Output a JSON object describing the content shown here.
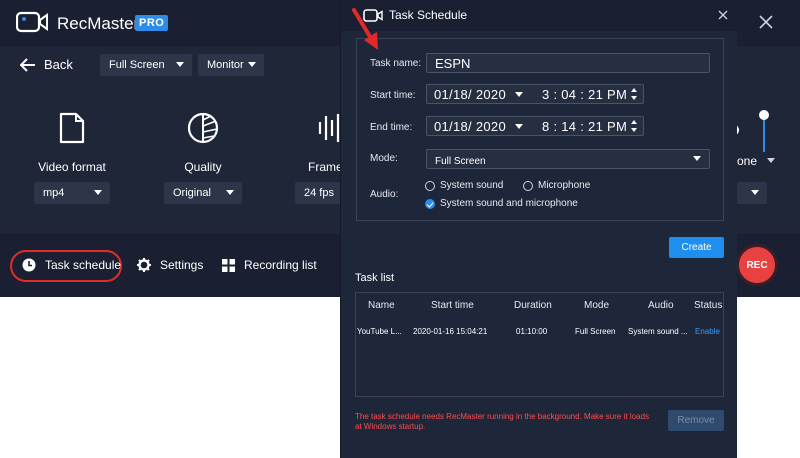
{
  "app": {
    "name": "RecMaster",
    "badge": "PRO"
  },
  "nav": {
    "back_label": "Back"
  },
  "toolbar": {
    "area_select": "Full Screen",
    "display_select": "Monitor"
  },
  "features": [
    {
      "label": "Video format",
      "value": "mp4",
      "icon": "file-icon"
    },
    {
      "label": "Quality",
      "value": "Original",
      "icon": "quality-dial-icon"
    },
    {
      "label": "Frame",
      "value": "24 fps",
      "icon": "frame-rate-icon"
    },
    {
      "label": "one",
      "icon": "microphone-icon"
    }
  ],
  "bottom": {
    "task_schedule": "Task schedule",
    "settings": "Settings",
    "recording_list": "Recording list",
    "rec": "REC"
  },
  "dialog": {
    "title": "Task Schedule",
    "task_name_label": "Task name:",
    "task_name_value": "ESPN",
    "start_label": "Start time:",
    "start_date": "01/18/ 2020",
    "start_time": "3 : 04 : 21  PM",
    "end_label": "End time:",
    "end_date": "01/18/ 2020",
    "end_time": "8 : 14 : 21  PM",
    "mode_label": "Mode:",
    "mode_value": "Full Screen",
    "audio_label": "Audio:",
    "audio_options": [
      "System sound",
      "Microphone",
      "System sound and microphone"
    ],
    "audio_selected": "System sound and microphone",
    "create_label": "Create",
    "tasklist_label": "Task list",
    "columns": [
      "Name",
      "Start time",
      "Duration",
      "Mode",
      "Audio",
      "Status"
    ],
    "rows": [
      {
        "name": "YouTube L...",
        "start": "2020-01-16 15:04:21",
        "duration": "01:10:00",
        "mode": "Full Screen",
        "audio": "System sound ...",
        "status": "Enable"
      }
    ],
    "warning": "The task schedule needs RecMaster running in the background. Make sure it loads at Windows startup.",
    "remove_label": "Remove"
  },
  "colors": {
    "accent": "#2d8ce8",
    "highlight": "#e12b2b",
    "rec": "#e84141"
  }
}
